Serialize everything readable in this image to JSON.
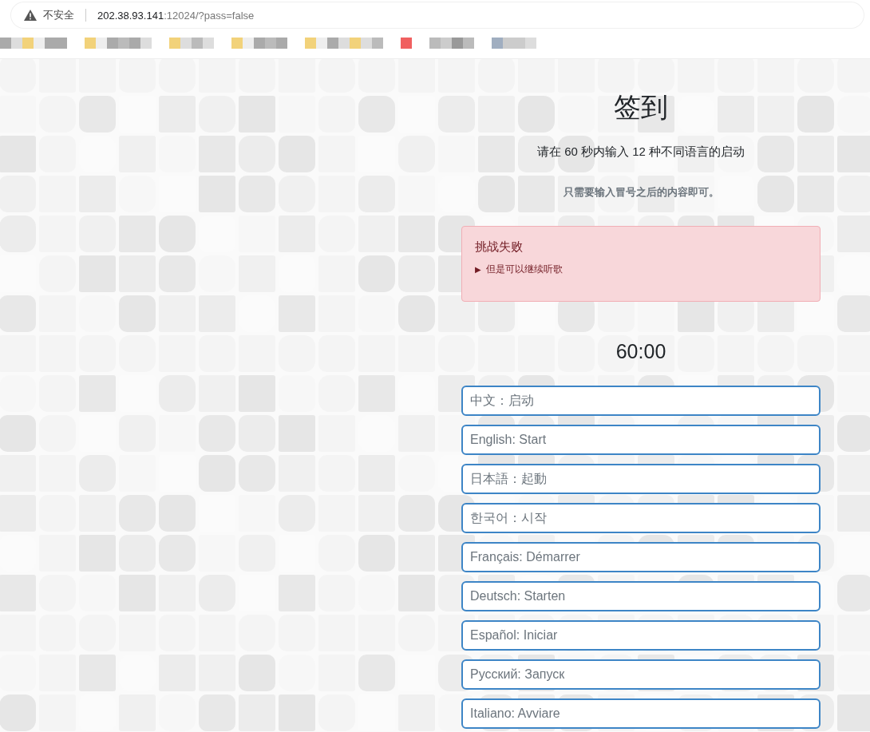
{
  "address_bar": {
    "security_label": "不安全",
    "url_host": "202.38.93.141",
    "url_rest": ":12024/?pass=false"
  },
  "title": "签到",
  "instruction": "请在 60 秒内输入 12 种不同语言的启动",
  "note": "只需要输入冒号之后的内容即可。",
  "alert": {
    "kind": "error",
    "title": "挑战失败",
    "disclosure": {
      "marker": "▶",
      "label": "但是可以继续听歌",
      "expanded": false
    }
  },
  "timer": "60:00",
  "fields": [
    {
      "placeholder": "中文：启动"
    },
    {
      "placeholder": "English: Start"
    },
    {
      "placeholder": "日本語：起動"
    },
    {
      "placeholder": "한국어：시작"
    },
    {
      "placeholder": "Français: Démarrer"
    },
    {
      "placeholder": "Deutsch: Starten"
    },
    {
      "placeholder": "Español: Iniciar"
    },
    {
      "placeholder": "Русский: Запуск"
    },
    {
      "placeholder": "Italiano: Avviare"
    }
  ]
}
